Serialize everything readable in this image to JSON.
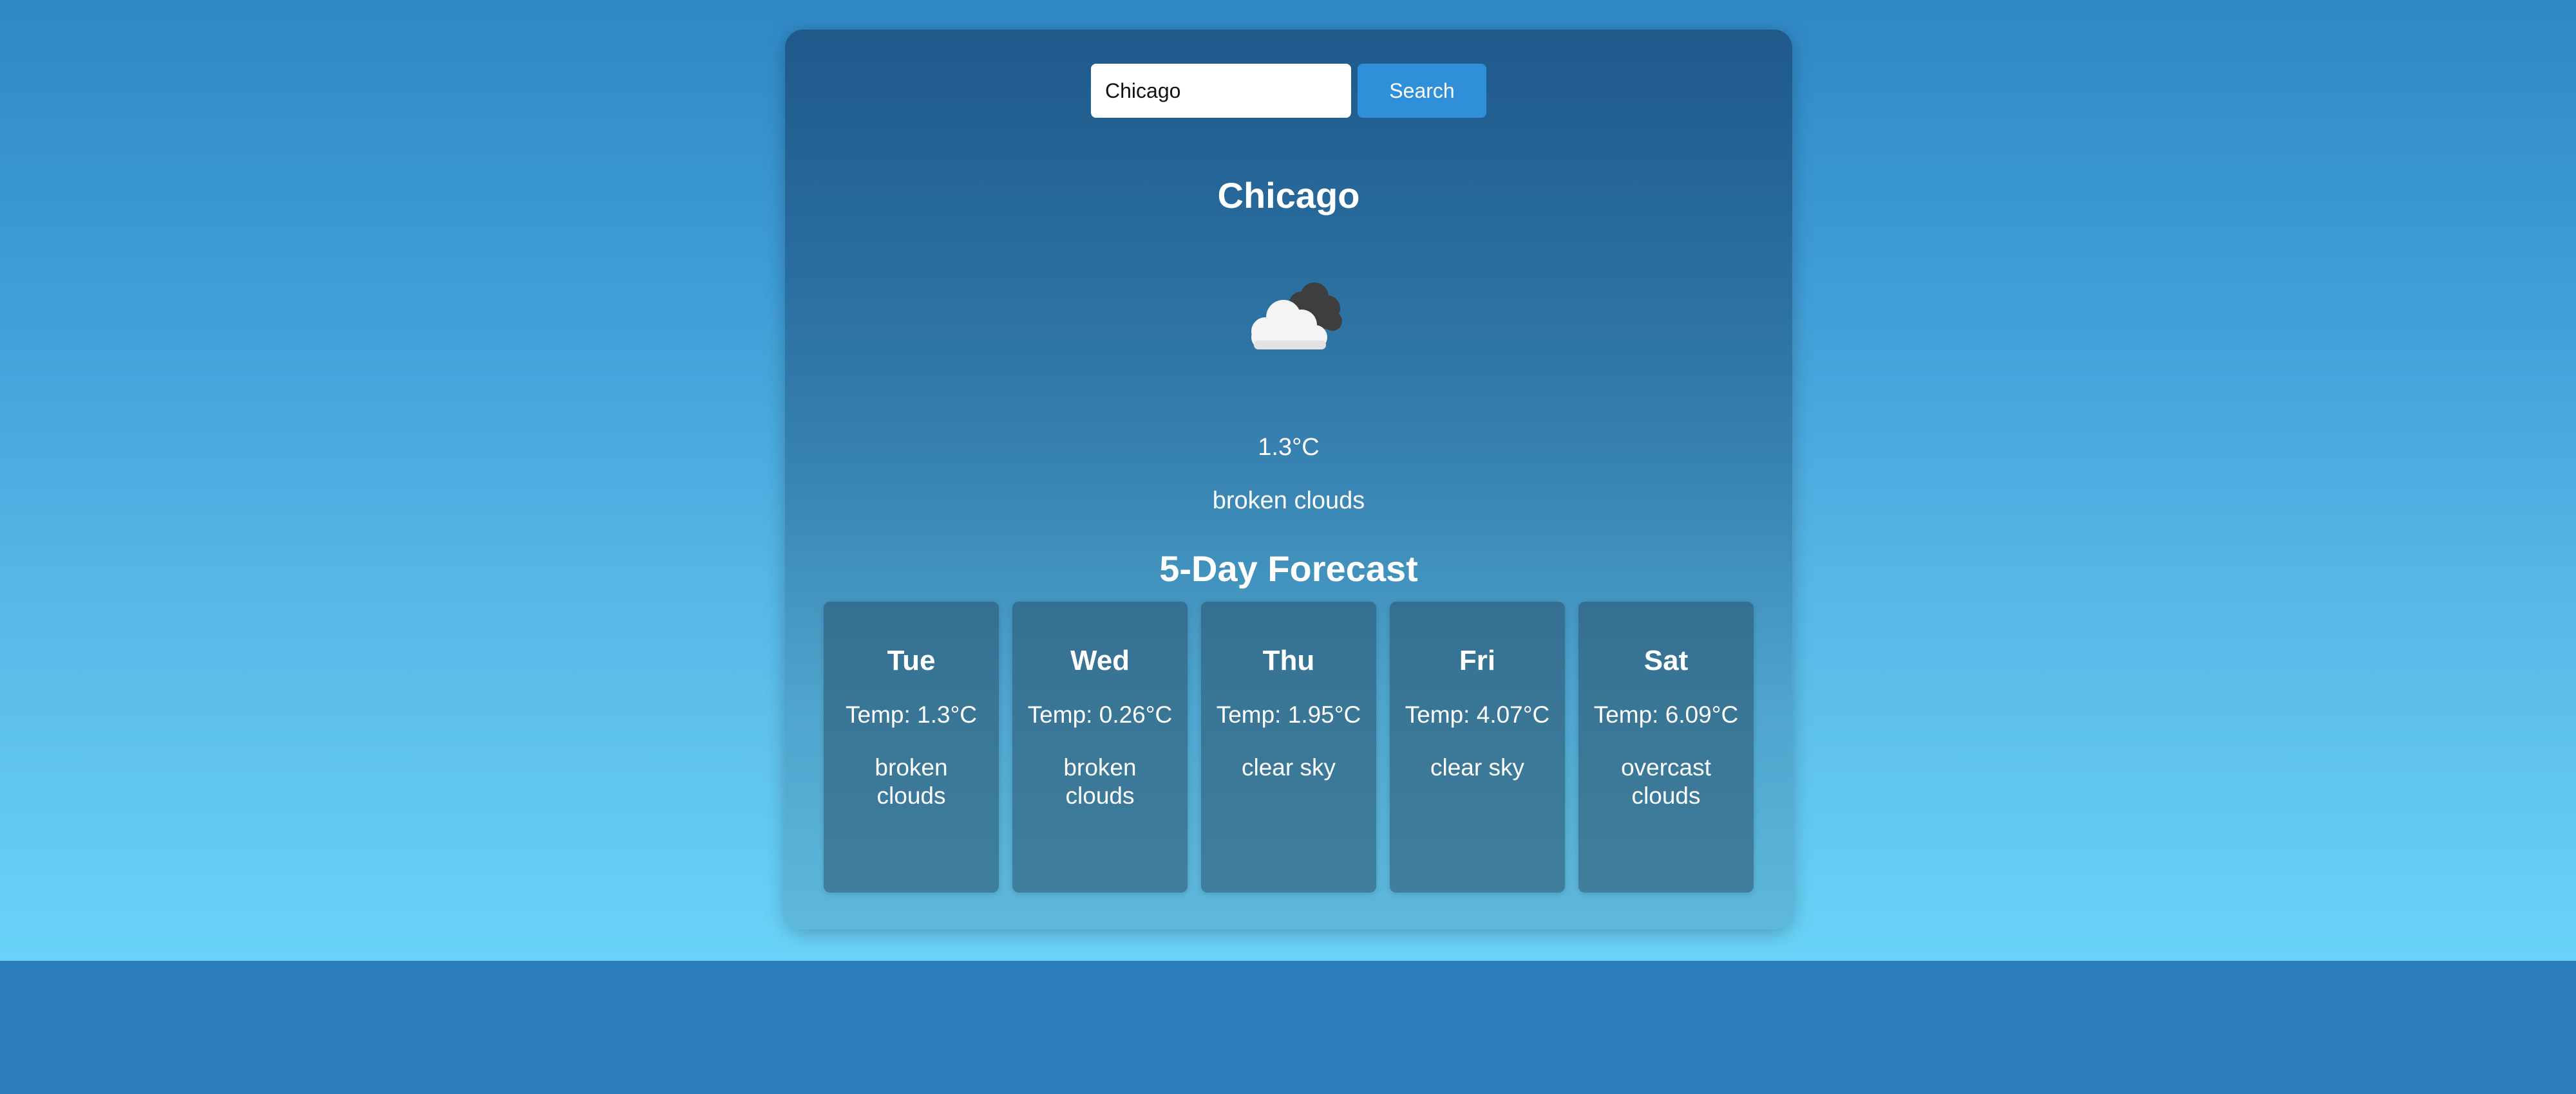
{
  "search": {
    "value": "Chicago",
    "button_label": "Search"
  },
  "current": {
    "city": "Chicago",
    "icon": "broken-clouds-icon",
    "temperature": "1.3°C",
    "description": "broken clouds"
  },
  "forecast": {
    "title": "5-Day Forecast",
    "days": [
      {
        "day": "Tue",
        "temp": "Temp: 1.3°C",
        "description": "broken clouds"
      },
      {
        "day": "Wed",
        "temp": "Temp: 0.26°C",
        "description": "broken clouds"
      },
      {
        "day": "Thu",
        "temp": "Temp: 1.95°C",
        "description": "clear sky"
      },
      {
        "day": "Fri",
        "temp": "Temp: 4.07°C",
        "description": "clear sky"
      },
      {
        "day": "Sat",
        "temp": "Temp: 6.09°C",
        "description": "overcast clouds"
      }
    ]
  },
  "colors": {
    "button": "#2f8fd8",
    "sky_top": "#2f88c6",
    "sky_bottom": "#6ad3f8",
    "footer": "#2b7db9"
  }
}
